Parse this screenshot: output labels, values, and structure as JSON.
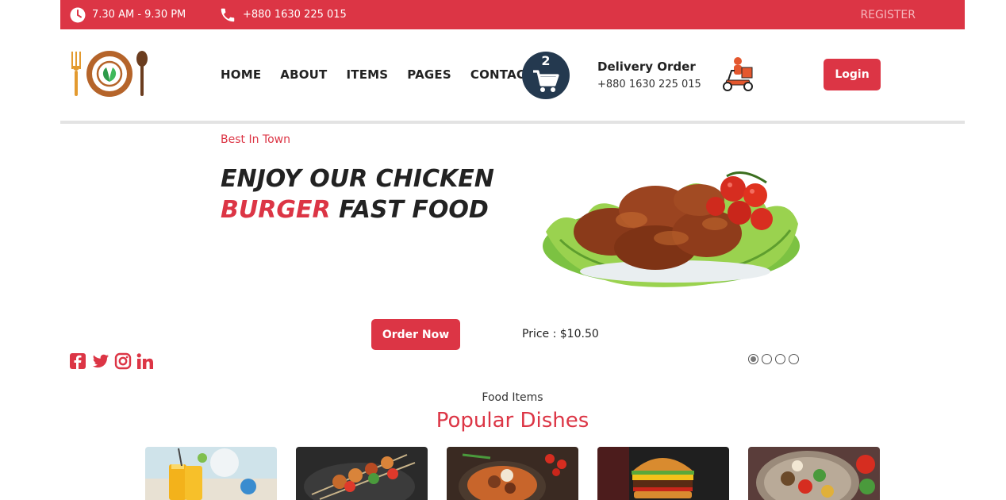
{
  "topbar": {
    "hours": "7.30 AM - 9.30 PM",
    "phone": "+880 1630 225 015",
    "register": "REGISTER"
  },
  "nav": {
    "items": [
      "HOME",
      "ABOUT",
      "ITEMS",
      "PAGES",
      "CONTACT"
    ]
  },
  "cart": {
    "count": "2"
  },
  "delivery": {
    "title": "Delivery Order",
    "phone": "+880 1630 225 015"
  },
  "header": {
    "login": "Login"
  },
  "hero": {
    "subtitle": "Best In Town",
    "title_line1": "ENJOY OUR CHICKEN",
    "title_highlight": "BURGER",
    "title_rest": " FAST FOOD",
    "order_button": "Order Now",
    "price": "Price : $10.50"
  },
  "social": [
    "facebook-icon",
    "twitter-icon",
    "instagram-icon",
    "linkedin-icon"
  ],
  "slider": {
    "total": 4,
    "active": 1
  },
  "section": {
    "subtitle": "Food Items",
    "title": "Popular Dishes"
  },
  "cards": [
    "juice",
    "kebab",
    "rice-dish",
    "burger",
    "grill-platter"
  ],
  "colors": {
    "accent": "#dc3545",
    "cart": "#24394f",
    "divider": "#e3e3e3"
  }
}
